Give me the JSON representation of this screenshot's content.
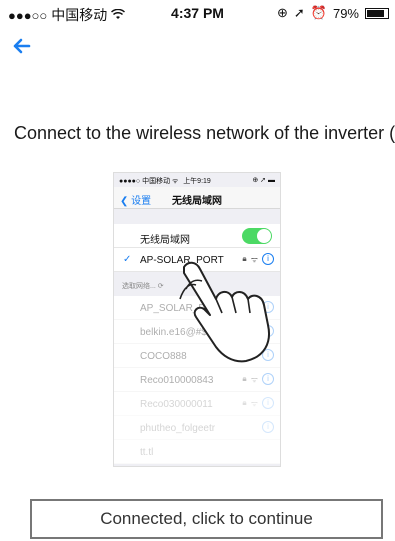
{
  "status_bar": {
    "signal": "●●●○○",
    "carrier": "中国移动",
    "time": "4:37 PM",
    "battery": "79%"
  },
  "instruction": "Connect to the wireless network of the inverter (..",
  "illustration": {
    "status": {
      "signal": "●●●●○",
      "carrier": "中国移动",
      "time": "上午9:19"
    },
    "nav": {
      "back_label": "设置",
      "title": "无线局域网"
    },
    "wifi_toggle_label": "无线局域网",
    "connected_network": "AP-SOLAR_PORT",
    "section_label": "选取网络...",
    "networks": [
      "AP_SOLAR_PORT",
      "belkin.e16@#$%^&*...",
      "COCO888",
      "Reco010000843",
      "Reco030000011",
      "phutheo_folgeetr",
      "tt.tl"
    ]
  },
  "continue_button": "Connected, click to continue",
  "colors": {
    "accent": "#1a7ef0",
    "toggle_on": "#4cd964"
  }
}
